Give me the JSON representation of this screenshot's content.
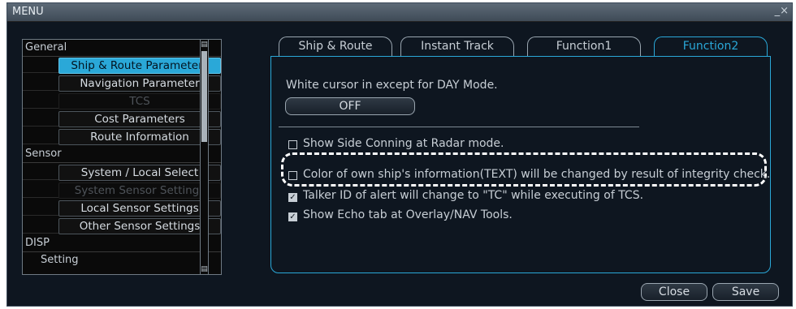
{
  "window": {
    "title": "MENU",
    "close_glyph": "_×"
  },
  "menu": {
    "categories": [
      "General",
      "Sensor",
      "DISP"
    ],
    "general_items": [
      "Ship & Route Parameters",
      "Navigation Parameter",
      "TCS",
      "Cost Parameters",
      "Route Information"
    ],
    "sensor_items": [
      "System / Local Select",
      "System Sensor Settings",
      "Local Sensor Settings",
      "Other Sensor Settings"
    ],
    "disp_items": [
      "Setting"
    ]
  },
  "tabs": [
    "Ship & Route",
    "Instant Track",
    "Function1",
    "Function2"
  ],
  "panel": {
    "white_cursor_label": "White cursor in except for DAY Mode.",
    "white_cursor_value": "OFF",
    "options": [
      {
        "label": "Show Side Conning at Radar mode.",
        "checked": false
      },
      {
        "label": "Color of own ship's information(TEXT) will be changed by result of integrity check.",
        "checked": false
      },
      {
        "label": "Talker ID of alert will change to \"TC\" while executing of TCS.",
        "checked": true
      },
      {
        "label": "Show Echo tab at Overlay/NAV Tools.",
        "checked": true
      }
    ]
  },
  "footer": {
    "close_label": "Close",
    "save_label": "Save"
  },
  "colors": {
    "accent": "#2aa8d8",
    "background": "#0e1620",
    "text": "#c7ced5"
  }
}
